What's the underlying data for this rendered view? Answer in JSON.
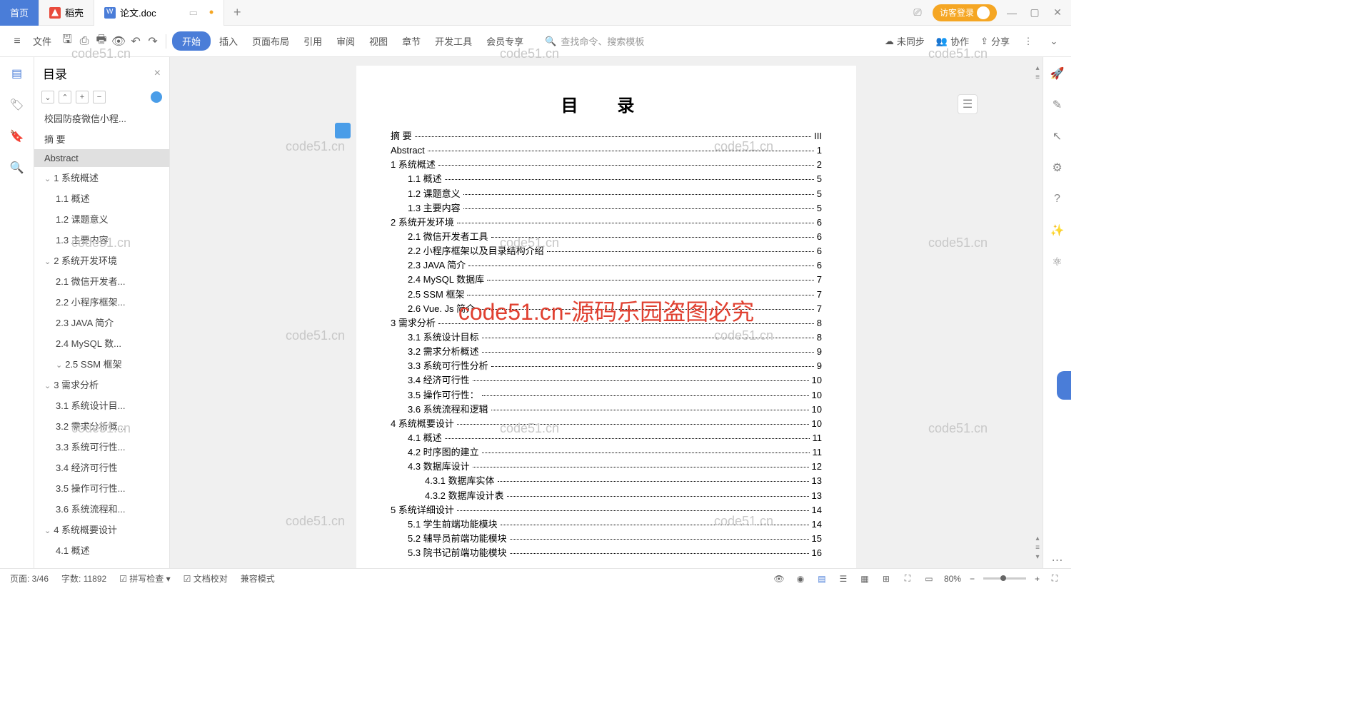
{
  "tabs": {
    "home": "首页",
    "dk": "稻壳",
    "doc": "论文.doc"
  },
  "login": "访客登录",
  "ribbon": {
    "menu": "文件",
    "items": [
      "开始",
      "插入",
      "页面布局",
      "引用",
      "审阅",
      "视图",
      "章节",
      "开发工具",
      "会员专享"
    ],
    "search": "查找命令、搜索模板",
    "sync": "未同步",
    "collab": "协作",
    "share": "分享"
  },
  "outline": {
    "title": "目录",
    "items": [
      {
        "t": "校园防疫微信小程...",
        "l": 1
      },
      {
        "t": "摘 要",
        "l": 1
      },
      {
        "t": "Abstract",
        "l": 1,
        "sel": true
      },
      {
        "t": "1 系统概述",
        "l": 1,
        "chev": true
      },
      {
        "t": "1.1 概述",
        "l": 2
      },
      {
        "t": "1.2 课题意义",
        "l": 2
      },
      {
        "t": "1.3 主要内容",
        "l": 2
      },
      {
        "t": "2 系统开发环境",
        "l": 1,
        "chev": true
      },
      {
        "t": "2.1 微信开发者...",
        "l": 2
      },
      {
        "t": "2.2 小程序框架...",
        "l": 2
      },
      {
        "t": "2.3 JAVA 简介",
        "l": 2
      },
      {
        "t": "2.4 MySQL 数...",
        "l": 2
      },
      {
        "t": "2.5 SSM 框架",
        "l": 2,
        "chev": true
      },
      {
        "t": "3 需求分析",
        "l": 1,
        "chev": true
      },
      {
        "t": "3.1 系统设计目...",
        "l": 2
      },
      {
        "t": "3.2 需求分析概...",
        "l": 2
      },
      {
        "t": "3.3 系统可行性...",
        "l": 2
      },
      {
        "t": "3.4 经济可行性",
        "l": 2
      },
      {
        "t": "3.5 操作可行性...",
        "l": 2
      },
      {
        "t": "3.6 系统流程和...",
        "l": 2
      },
      {
        "t": "4 系统概要设计",
        "l": 1,
        "chev": true
      },
      {
        "t": "4.1 概述",
        "l": 2
      }
    ]
  },
  "doc": {
    "title": "目  录",
    "toc": [
      {
        "t": "摘 要",
        "p": "III",
        "l": 1
      },
      {
        "t": "Abstract",
        "p": "1",
        "l": 1
      },
      {
        "t": "1 系统概述",
        "p": "2",
        "l": 1
      },
      {
        "t": "1.1 概述",
        "p": "5",
        "l": 2
      },
      {
        "t": "1.2 课题意义",
        "p": "5",
        "l": 2
      },
      {
        "t": "1.3 主要内容",
        "p": "5",
        "l": 2
      },
      {
        "t": "2 系统开发环境",
        "p": "6",
        "l": 1
      },
      {
        "t": "2.1 微信开发者工具",
        "p": "6",
        "l": 2
      },
      {
        "t": "2.2 小程序框架以及目录结构介绍",
        "p": "6",
        "l": 2
      },
      {
        "t": "2.3 JAVA 简介",
        "p": "6",
        "l": 2
      },
      {
        "t": "2.4 MySQL 数据库",
        "p": "7",
        "l": 2
      },
      {
        "t": "2.5 SSM 框架",
        "p": "7",
        "l": 2
      },
      {
        "t": "2.6 Vue. Js 简介",
        "p": "7",
        "l": 2
      },
      {
        "t": "3 需求分析",
        "p": "8",
        "l": 1
      },
      {
        "t": "3.1 系统设计目标",
        "p": "8",
        "l": 2
      },
      {
        "t": "3.2 需求分析概述",
        "p": "9",
        "l": 2
      },
      {
        "t": "3.3 系统可行性分析",
        "p": "9",
        "l": 2
      },
      {
        "t": "3.4 经济可行性",
        "p": "10",
        "l": 2
      },
      {
        "t": "3.5 操作可行性：",
        "p": "10",
        "l": 2
      },
      {
        "t": "3.6 系统流程和逻辑",
        "p": "10",
        "l": 2
      },
      {
        "t": "4 系统概要设计",
        "p": "10",
        "l": 1
      },
      {
        "t": "4.1 概述",
        "p": "11",
        "l": 2
      },
      {
        "t": "4.2 时序图的建立",
        "p": "11",
        "l": 2
      },
      {
        "t": "4.3 数据库设计",
        "p": "12",
        "l": 2
      },
      {
        "t": "4.3.1 数据库实体",
        "p": "13",
        "l": 3
      },
      {
        "t": "4.3.2 数据库设计表",
        "p": "13",
        "l": 3
      },
      {
        "t": "5 系统详细设计",
        "p": "14",
        "l": 1
      },
      {
        "t": "5.1 学生前端功能模块",
        "p": "14",
        "l": 2
      },
      {
        "t": "5.2 辅导员前端功能模块",
        "p": "15",
        "l": 2
      },
      {
        "t": "5.3 院书记前端功能模块",
        "p": "16",
        "l": 2
      }
    ]
  },
  "redmark": "code51.cn-源码乐园盗图必究",
  "wm": "code51.cn",
  "status": {
    "page": "页面: 3/46",
    "words": "字数: 11892",
    "spell": "拼写检查",
    "proof": "文档校对",
    "compat": "兼容模式",
    "zoom": "80%"
  }
}
